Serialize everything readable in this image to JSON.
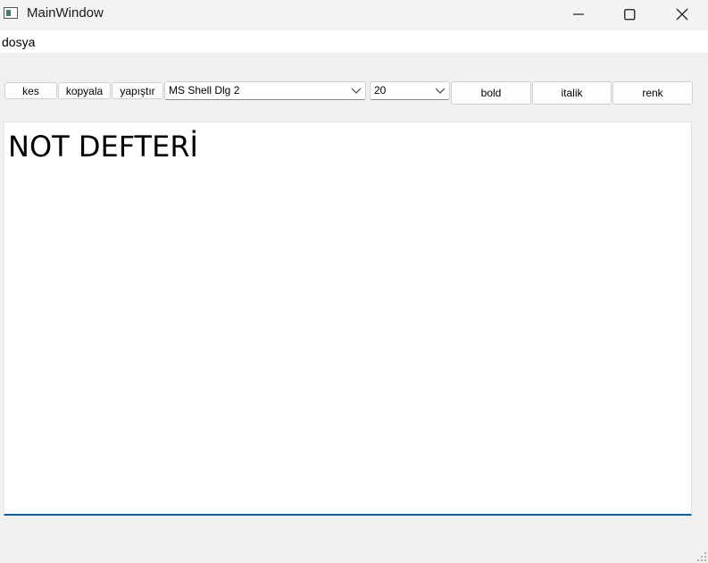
{
  "window": {
    "title": "MainWindow",
    "icons": {
      "app": "app-window-icon",
      "minimize": "minimize-icon",
      "maximize": "maximize-icon",
      "close": "close-icon"
    }
  },
  "menubar": {
    "items": [
      {
        "label": "dosya"
      }
    ]
  },
  "toolbar": {
    "cut_label": "kes",
    "copy_label": "kopyala",
    "paste_label": "yapıştır",
    "font_family": {
      "selected": "MS Shell Dlg 2"
    },
    "font_size": {
      "selected": "20"
    },
    "bold_label": "bold",
    "italic_label": "italik",
    "color_label": "renk"
  },
  "editor": {
    "content": "NOT DEFTERİ"
  },
  "colors": {
    "focus_accent": "#0a5fa8",
    "window_bg": "#f0f0f0"
  }
}
